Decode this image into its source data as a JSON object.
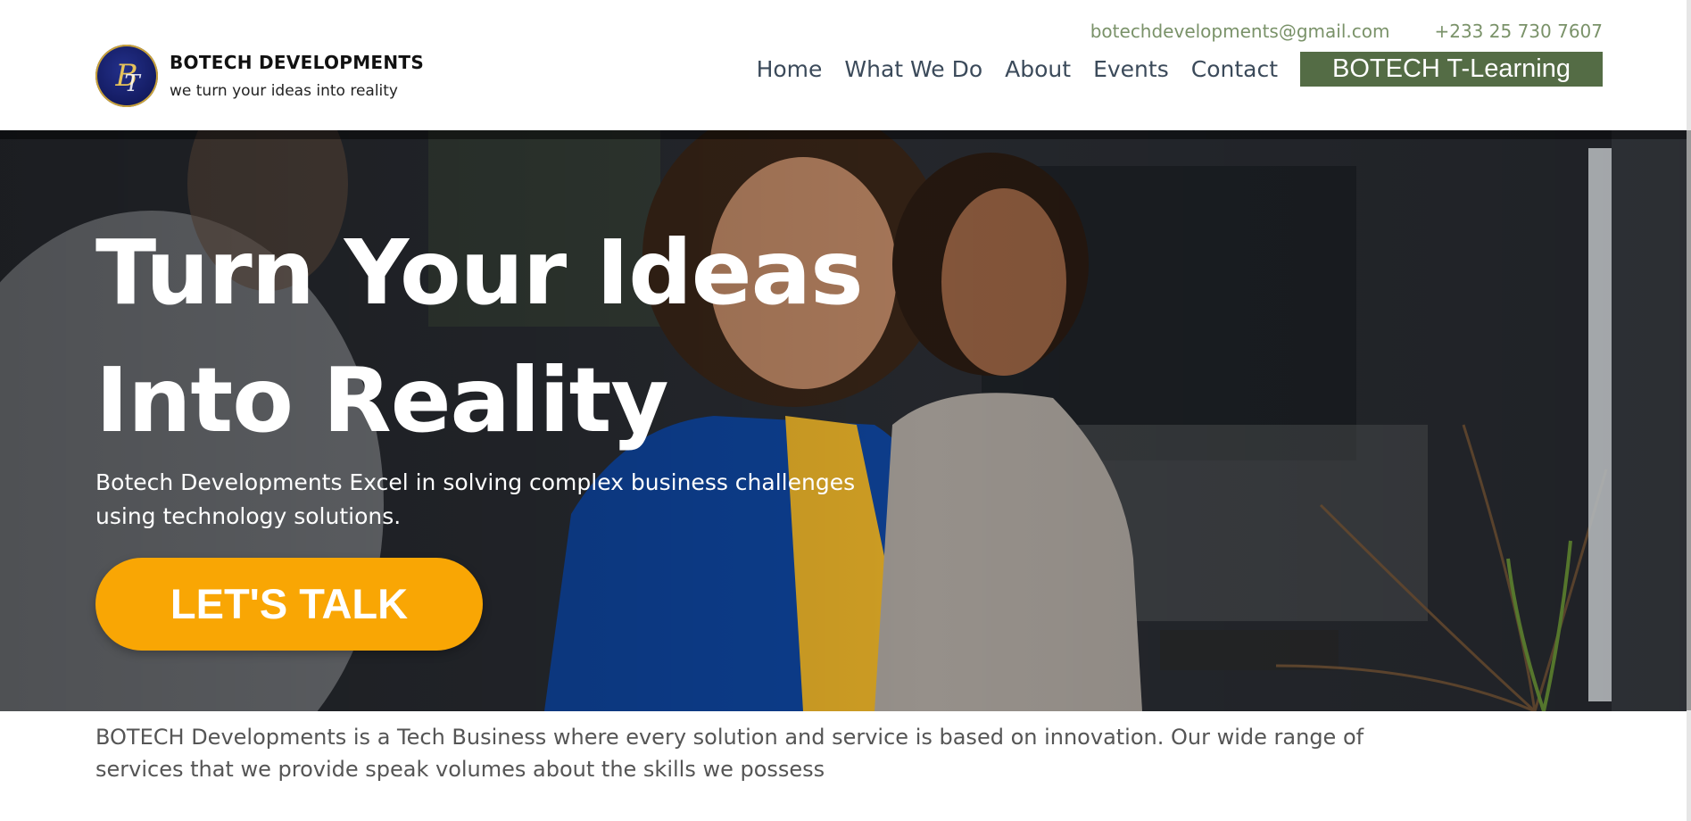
{
  "header": {
    "brand_name": "BOTECH DEVELOPMENTS",
    "tagline": "we turn your ideas into reality",
    "logo_letters": "BT",
    "email": "botechdevelopments@gmail.com",
    "phone": "+233 25 730 7607",
    "nav": [
      {
        "label": "Home"
      },
      {
        "label": "What We Do"
      },
      {
        "label": "About"
      },
      {
        "label": "Events"
      },
      {
        "label": "Contact"
      }
    ],
    "cta_label": "BOTECH T-Learning"
  },
  "hero": {
    "title_line1": "Turn Your Ideas",
    "title_line2": "Into Reality",
    "subtitle": "Botech Developments Excel in solving complex business challenges using technology solutions.",
    "cta_label": "LET'S TALK"
  },
  "intro": {
    "text": "BOTECH Developments is a Tech Business where every solution and service is based on innovation. Our wide range of services that we provide speak volumes about the skills we possess"
  },
  "colors": {
    "accent_green": "#546c45",
    "cta_orange": "#f9a604",
    "contact_green": "#7a9269",
    "nav_text": "#3b4a5a"
  }
}
